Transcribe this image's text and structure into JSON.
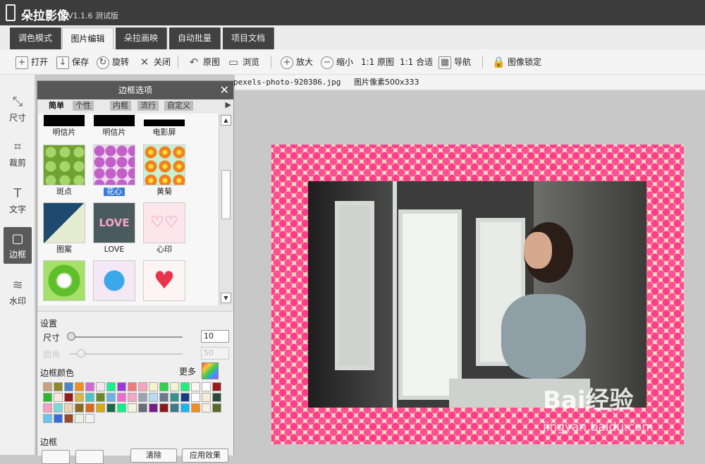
{
  "app": {
    "name": "朵拉影像",
    "version": "V1.1.6",
    "edition": "测试版"
  },
  "tabs": [
    {
      "label": "调色模式"
    },
    {
      "label": "图片编辑",
      "active": true
    },
    {
      "label": "朵拉画映"
    },
    {
      "label": "自动批量"
    },
    {
      "label": "项目文档"
    }
  ],
  "toolbar": {
    "open": "打开",
    "save": "保存",
    "rotate": "旋转",
    "close": "关闭",
    "original": "原图",
    "browse": "浏览",
    "zoom_in": "放大",
    "zoom_out": "缩小",
    "one_to_one_original": "1:1 原图",
    "one_to_one_fit": "1:1 合适",
    "navigate": "导航",
    "lock": "图像锁定"
  },
  "left_tools": [
    {
      "label": "尺寸",
      "icon": "resize-icon"
    },
    {
      "label": "裁剪",
      "icon": "crop-icon"
    },
    {
      "label": "文字",
      "icon": "text-icon"
    },
    {
      "label": "边框",
      "icon": "border-icon",
      "active": true
    },
    {
      "label": "水印",
      "icon": "watermark-icon"
    }
  ],
  "panel": {
    "title": "边框选项",
    "subtabs": [
      "简单",
      "个性",
      "内框",
      "流行",
      "自定义"
    ],
    "active_subtab": "简单",
    "top_row": [
      "明信片",
      "明信片",
      "电影屏"
    ],
    "frames": [
      {
        "label": "斑点",
        "color": "#7bb43c"
      },
      {
        "label": "花心",
        "color": "#cc66cc",
        "selected": true
      },
      {
        "label": "黄菊",
        "color": "#f3a42a"
      },
      {
        "label": "图案",
        "color": "#1f4a6f"
      },
      {
        "label": "LOVE",
        "color": "#4a5a5e"
      },
      {
        "label": "心印",
        "color": "#f9c6d0"
      },
      {
        "label": "",
        "color": "#5fbf2a"
      },
      {
        "label": "",
        "color": "#3aa8e8"
      },
      {
        "label": "",
        "color": "#e8334a"
      }
    ],
    "settings_label": "设置",
    "size_label": "尺寸",
    "size_value": "10",
    "radius_label": "圆角",
    "radius_value": "50",
    "color_label": "边框颜色",
    "more_label": "更多",
    "palette": [
      "#c8a27c",
      "#8a8a2a",
      "#4a86c8",
      "#f28c1c",
      "#d46ad4",
      "#f6e6ee",
      "#18f08a",
      "#9b3ad8",
      "#f07a7a",
      "#f6a4b8",
      "#f6f3c9",
      "#2ed04a",
      "#ecf6d2",
      "#1cf07a",
      "#fef6ee",
      "#fefefe",
      "#9b1a1a",
      "#2ab82a",
      "#fce8e0",
      "#9a1a1a",
      "#d4b84a",
      "#4ac4c4",
      "#6a8a2a",
      "#6ab4e4",
      "#f06ad0",
      "#f4a6c4",
      "#9aa4b0",
      "#b8d8f4",
      "#6a7a8a",
      "#3a9090",
      "#1a3a8a",
      "#fefefe",
      "#f6ecd8",
      "#2a4a3a",
      "#f4a0c4",
      "#7adada",
      "#e8d4b0",
      "#8a6a1a",
      "#d46a1a",
      "#d8a81a",
      "#1a6a4a",
      "#0af08a",
      "#f6f2dc",
      "#6a6a7a",
      "#7a1a8a",
      "#8a1a1a",
      "#3a7a8a",
      "#1ab4f0",
      "#f28c1c",
      "#f6f0e0",
      "#5a6a2a",
      "#6ac4f0",
      "#3a6ad8",
      "#9a4a2a",
      "#e8f2e0",
      "#f2f2f2"
    ],
    "border_label": "边框",
    "bottom_buttons": [
      "",
      "",
      "清除",
      "应用效果"
    ]
  },
  "canvas": {
    "filename": "pexels-photo-920386.jpg",
    "pixels": "图片像素500x333"
  },
  "watermark": {
    "logo": "Bai经验",
    "url": "jingyan.baidu.com"
  }
}
